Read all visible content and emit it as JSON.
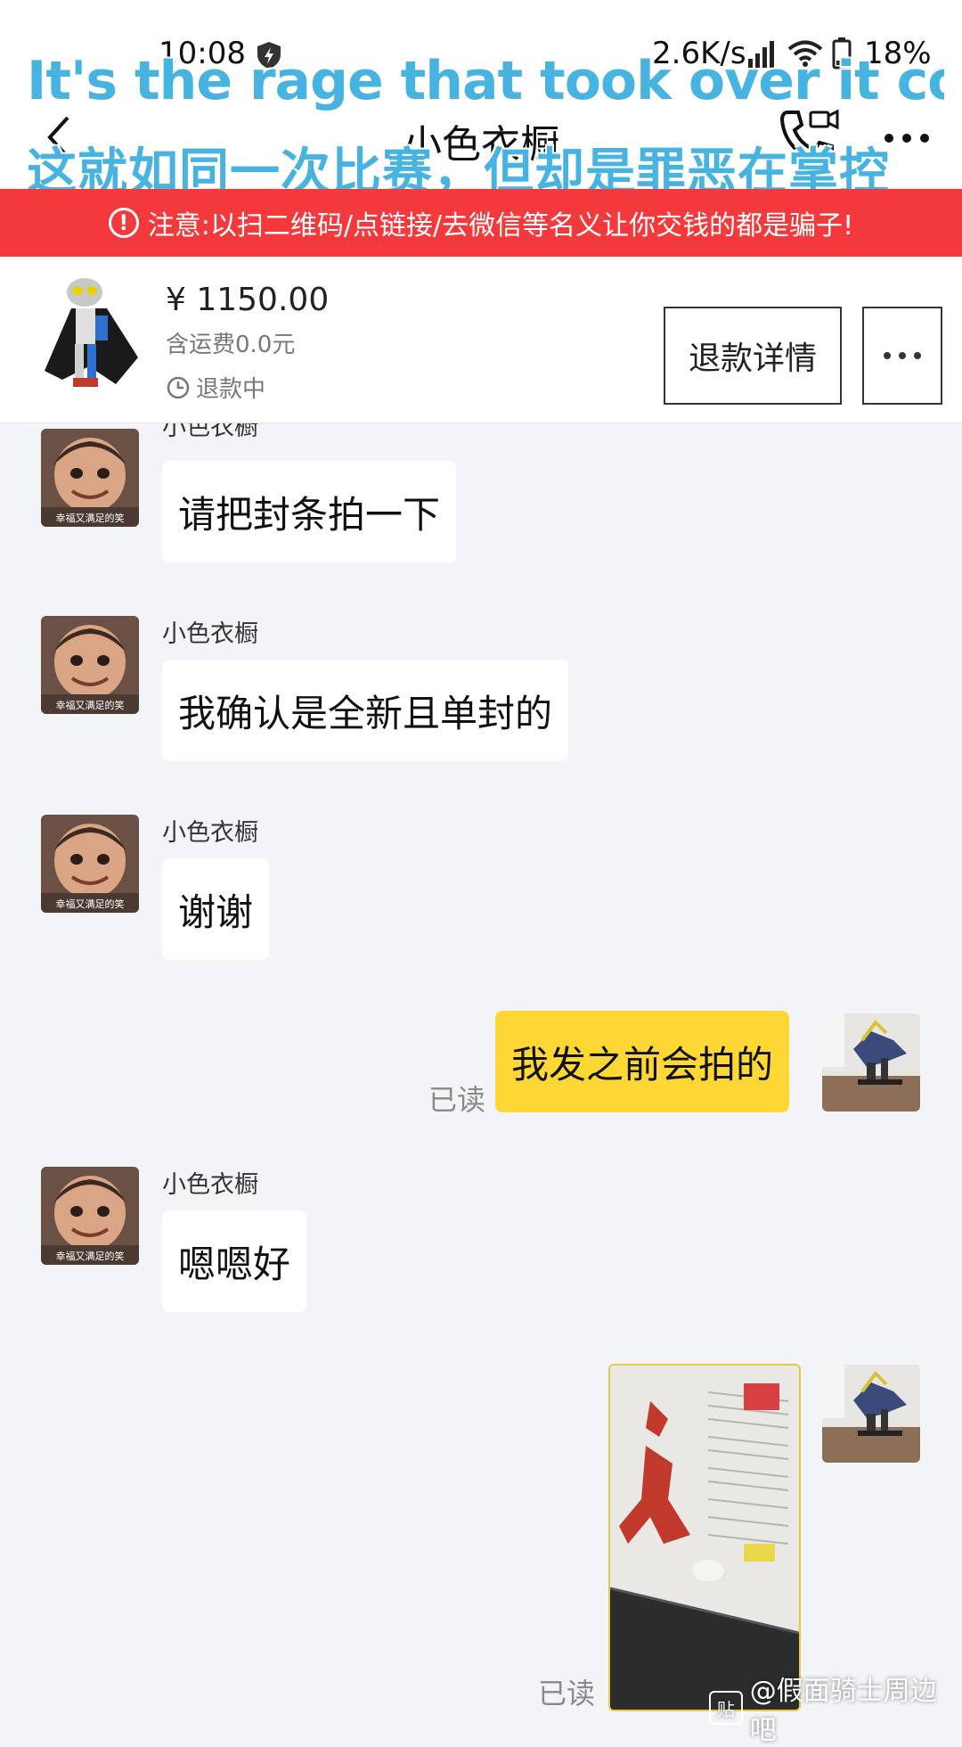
{
  "status_bar": {
    "time": "10:08",
    "network_speed": "2.6K/s",
    "battery": "18%"
  },
  "nav": {
    "title": "小色衣橱"
  },
  "overlay": {
    "line_en": "It's the rage that took over it control",
    "line_cn": "这就如同一次比赛，但却是罪恶在掌控"
  },
  "warning": {
    "text": "注意:以扫二维码/点链接/去微信等名义让你交钱的都是骗子!"
  },
  "order": {
    "price": "¥ 1150.00",
    "shipping": "含运费0.0元",
    "status": "退款中",
    "refund_button": "退款详情"
  },
  "chat": {
    "messages": [
      {
        "side": "left",
        "sender": "小色衣橱",
        "text": "请把封条拍一下"
      },
      {
        "side": "left",
        "sender": "小色衣橱",
        "text": "我确认是全新且单封的"
      },
      {
        "side": "left",
        "sender": "小色衣橱",
        "text": "谢谢"
      },
      {
        "side": "right",
        "text": "我发之前会拍的",
        "read": "已读"
      },
      {
        "side": "left",
        "sender": "小色衣橱",
        "text": "嗯嗯好"
      },
      {
        "side": "right",
        "type": "image",
        "read": "已读"
      }
    ],
    "avatar_caption": "幸福又满足的笑"
  },
  "watermark": {
    "logo": "贴",
    "text": "@假面骑士周边吧"
  },
  "colors": {
    "warning_bg": "#f4393c",
    "my_bubble": "#fdd835",
    "overlay_text": "#46b3e0",
    "chat_bg": "#f3f4f8"
  }
}
